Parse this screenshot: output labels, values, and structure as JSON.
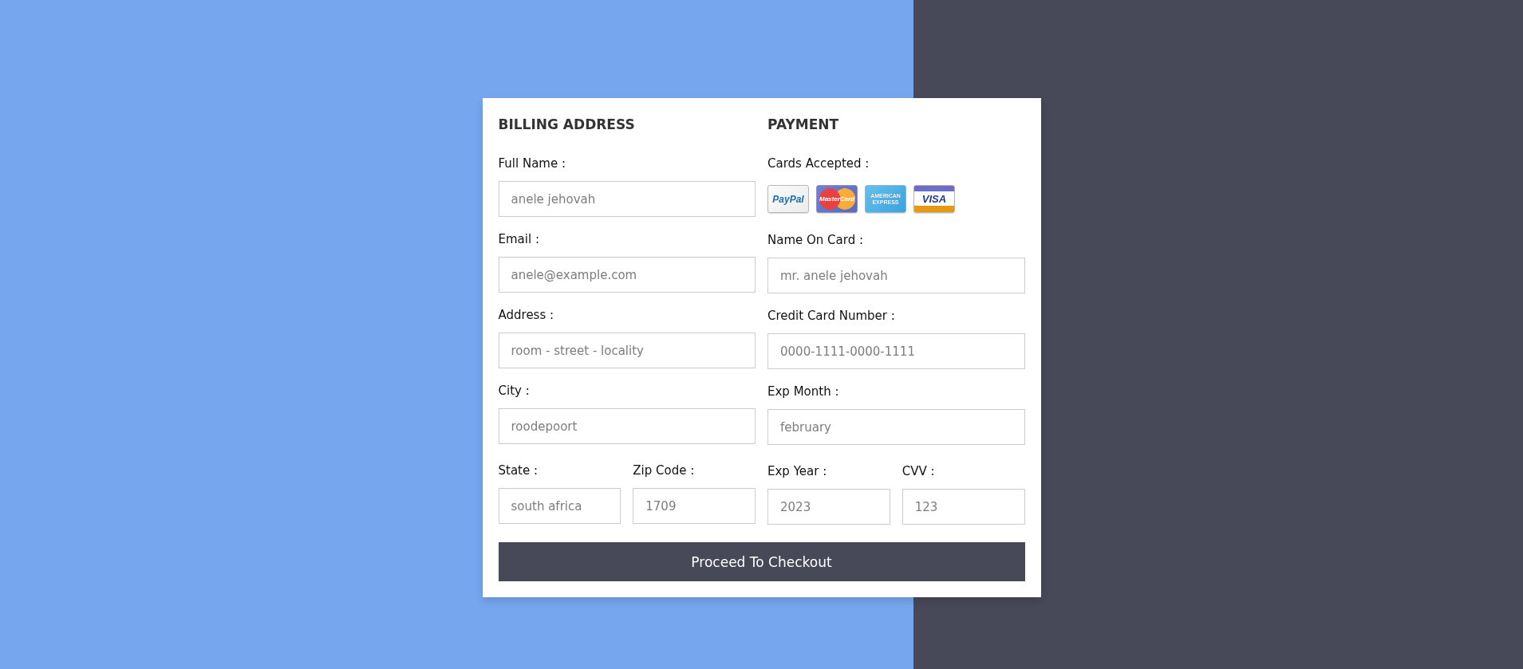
{
  "columns": [
    {
      "title": "BILLING ADDRESS",
      "fields": [
        {
          "label": "Full Name :",
          "placeholder": "anele jehovah"
        },
        {
          "label": "Email :",
          "placeholder": "anele@example.com"
        },
        {
          "label": "Address :",
          "placeholder": "room - street - locality"
        },
        {
          "label": "City :",
          "placeholder": "roodepoort"
        }
      ],
      "split_fields": [
        {
          "label": "State :",
          "placeholder": "south africa"
        },
        {
          "label": "Zip Code :",
          "placeholder": "1709"
        }
      ]
    },
    {
      "title": "PAYMENT",
      "cards_accepted": {
        "label": "Cards Accepted :",
        "logos": [
          {
            "kind": "paypal",
            "text": "PayPal"
          },
          {
            "kind": "mastercard",
            "text": "MasterCard"
          },
          {
            "kind": "amex",
            "text": "AMERICAN EXPRESS"
          },
          {
            "kind": "visa",
            "text": "VISA"
          }
        ]
      },
      "fields": [
        {
          "label": "Name On Card :",
          "placeholder": "mr. anele jehovah"
        },
        {
          "label": "Credit Card Number :",
          "placeholder": "0000-1111-0000-1111"
        },
        {
          "label": "Exp Month :",
          "placeholder": "february"
        }
      ],
      "split_fields": [
        {
          "label": "Exp Year :",
          "placeholder": "2023"
        },
        {
          "label": "CVV :",
          "placeholder": "123"
        }
      ]
    }
  ],
  "checkout_button": {
    "label": "Proceed To Checkout"
  }
}
